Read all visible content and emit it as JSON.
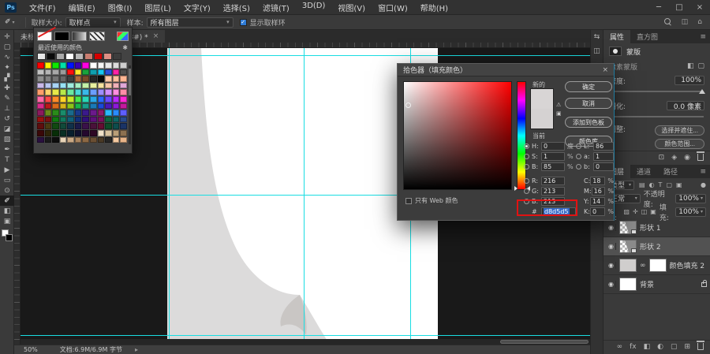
{
  "colors": {
    "guide": "#19dde2",
    "page_bg": "#dcdbdb",
    "page": "#ffffff",
    "curl": "#c9c6c4",
    "picker": "#d8d5d5",
    "selection_blue": "#3166c6",
    "annotation_red": "#e11212",
    "check_blue": "#2e7bd6"
  },
  "menubar": {
    "logo": "Ps",
    "items": [
      "文件(F)",
      "编辑(E)",
      "图像(I)",
      "图层(L)",
      "文字(Y)",
      "选择(S)",
      "滤镜(T)",
      "3D(D)",
      "视图(V)",
      "窗口(W)",
      "帮助(H)"
    ],
    "window_controls": [
      "─",
      "□",
      "×"
    ]
  },
  "options_bar": {
    "tool_glyph": "✐",
    "sample_size_label": "取样大小:",
    "sample_size_value": "取样点",
    "sample_label": "样本:",
    "sample_value": "所有图层",
    "check_glyph": "✓",
    "show_ring_label": "显示取样环"
  },
  "tab": {
    "title": "未标题-1 @ 33.3%(形状 1, RGB/8#) *",
    "close": "×"
  },
  "toolbar": {
    "tools": [
      {
        "name": "move-tool",
        "glyph": "✛",
        "selected": false
      },
      {
        "name": "marquee-tool",
        "glyph": "▢",
        "selected": false
      },
      {
        "name": "lasso-tool",
        "glyph": "∿",
        "selected": false
      },
      {
        "name": "magic-wand-tool",
        "glyph": "✦",
        "selected": false
      },
      {
        "name": "crop-tool",
        "glyph": "▞",
        "selected": false
      },
      {
        "name": "healing-brush-tool",
        "glyph": "✚",
        "selected": false
      },
      {
        "name": "brush-tool",
        "glyph": "✎",
        "selected": false
      },
      {
        "name": "clone-stamp-tool",
        "glyph": "⊥",
        "selected": false
      },
      {
        "name": "history-brush-tool",
        "glyph": "↺",
        "selected": false
      },
      {
        "name": "eraser-tool",
        "glyph": "◪",
        "selected": false
      },
      {
        "name": "gradient-tool",
        "glyph": "▧",
        "selected": false
      },
      {
        "name": "pen-tool",
        "glyph": "✒",
        "selected": false
      },
      {
        "name": "type-tool",
        "glyph": "T",
        "selected": false
      },
      {
        "name": "path-select-tool",
        "glyph": "▶",
        "selected": false
      },
      {
        "name": "rectangle-tool",
        "glyph": "▭",
        "selected": false
      },
      {
        "name": "zoom-tool",
        "glyph": "⊙",
        "selected": false
      },
      {
        "name": "eyedropper-tool",
        "glyph": "✐",
        "selected": true
      },
      {
        "name": "quick-mask-icon",
        "glyph": "◧",
        "selected": false
      },
      {
        "name": "screen-mode-icon",
        "glyph": "▣",
        "selected": false
      }
    ],
    "foreground": "#ffffff",
    "background": "#000000"
  },
  "swatches": {
    "label": "最近使用的颜色",
    "recent": [
      "#e8e8e8",
      "#0a0a0a",
      "#a8a8a8",
      "#ffffff",
      "#b8b8b8",
      "#c97d70",
      "#d40000",
      "#dd8f84",
      "#3d3d3d"
    ],
    "grid": [
      "#ff0000",
      "#fff000",
      "#0fe800",
      "#00e0a8",
      "#0014ff",
      "#3a00b4",
      "#ff00e1",
      "#ffffff",
      "#f5f5f5",
      "#e9e9e9",
      "#dcdcdc",
      "#cfcfcf",
      "#c2c2c2",
      "#b5b5b5",
      "#a8a8a8",
      "#9b9b9b",
      "#ff1010",
      "#ffe92c",
      "#1aa33c",
      "#0f9faf",
      "#19c7f0",
      "#2b4fd8",
      "#ff22a8",
      "#4d4d4d",
      "#8e8e8e",
      "#818181",
      "#747474",
      "#676767",
      "#3f3f3f",
      "#b0693c",
      "#7a4a2a",
      "#262626",
      "#0a0a0a",
      "#ffc9a8",
      "#ffbf9e",
      "#ffb694",
      "#c9b8e8",
      "#b8c6f0",
      "#a8d4f5",
      "#98e2f5",
      "#a0ece0",
      "#a8f0c4",
      "#c4f0a8",
      "#e8f0a0",
      "#f5e2a0",
      "#f5c6a8",
      "#f0b0b8",
      "#e0a8d8",
      "#ff9e6b",
      "#ffd26b",
      "#e8e84a",
      "#b8e84a",
      "#6be8a0",
      "#4ad8d8",
      "#3ab8e8",
      "#6b9eff",
      "#9e8eff",
      "#d08eff",
      "#ff8ee0",
      "#ff8ea8",
      "#ff6ba8",
      "#ff4a4a",
      "#ff8c2a",
      "#ffd42a",
      "#c9e82a",
      "#4ae84a",
      "#2ad8b8",
      "#2aa8e8",
      "#2a6bff",
      "#6b4aff",
      "#b82aff",
      "#ff2ad8",
      "#d82a8c",
      "#b81a1a",
      "#d86b1a",
      "#d8b41a",
      "#8cc41a",
      "#1ab44a",
      "#1a9e8c",
      "#1a7ab8",
      "#1a4ad8",
      "#4a1ab8",
      "#8c1ad8",
      "#c41a9e",
      "#8c1a5e",
      "#6b8c1a",
      "#2a8c1a",
      "#1a8c6b",
      "#1a6b8c",
      "#1a3a8c",
      "#3a1a8c",
      "#6b1a8c",
      "#8c1a6b",
      "#2ab8ff",
      "#2a8cff",
      "#5e5eff",
      "#991111",
      "#7a1111",
      "#117a11",
      "#117a5e",
      "#11607a",
      "#11307a",
      "#30117a",
      "#5e117a",
      "#7a1160",
      "#0f6640",
      "#0f6666",
      "#284b8c",
      "#5e0d0d",
      "#4a3a11",
      "#114a11",
      "#114a3a",
      "#11304a",
      "#1a1a4a",
      "#3a114a",
      "#4a113a",
      "#660d33",
      "#0d4d29",
      "#0d4d4d",
      "#1a3366",
      "#3a0808",
      "#2e2408",
      "#082e08",
      "#082e24",
      "#081e2e",
      "#10102e",
      "#24082e",
      "#2e0824",
      "#f0e2c9",
      "#d8c4a0",
      "#b89e78",
      "#8c7050",
      "#2a1040",
      "#1a1a1a",
      "#0d0d0d",
      "#e8d4b8",
      "#c9a884",
      "#a8825e",
      "#8c6844",
      "#6b4f33",
      "#4a3a26",
      "#262626",
      "#f5c9a0",
      "#e8b488"
    ]
  },
  "dialog": {
    "title": "拾色器（填充颜色）",
    "close": "×",
    "new_label": "新的",
    "current_label": "当前",
    "buttons": {
      "ok": "确定",
      "cancel": "取消",
      "add_to_swatches": "添加到色板",
      "color_libraries": "颜色库"
    },
    "fields_left": [
      {
        "radio": true,
        "checked": true,
        "label": "H:",
        "value": "0",
        "unit": "度"
      },
      {
        "radio": true,
        "checked": false,
        "label": "S:",
        "value": "1",
        "unit": "%"
      },
      {
        "radio": true,
        "checked": false,
        "label": "B:",
        "value": "85",
        "unit": "%"
      },
      {
        "radio": true,
        "checked": false,
        "label": "R:",
        "value": "216",
        "unit": ""
      },
      {
        "radio": true,
        "checked": false,
        "label": "G:",
        "value": "213",
        "unit": ""
      },
      {
        "radio": true,
        "checked": false,
        "label": "B:",
        "value": "213",
        "unit": ""
      }
    ],
    "fields_right": [
      {
        "radio": true,
        "checked": false,
        "label": "L:",
        "value": "86",
        "unit": ""
      },
      {
        "radio": true,
        "checked": false,
        "label": "a:",
        "value": "1",
        "unit": ""
      },
      {
        "radio": true,
        "checked": false,
        "label": "b:",
        "value": "0",
        "unit": ""
      },
      {
        "radio": false,
        "checked": false,
        "label": "C:",
        "value": "18",
        "unit": "%"
      },
      {
        "radio": false,
        "checked": false,
        "label": "M:",
        "value": "16",
        "unit": "%"
      },
      {
        "radio": false,
        "checked": false,
        "label": "Y:",
        "value": "14",
        "unit": "%"
      },
      {
        "radio": false,
        "checked": false,
        "label": "K:",
        "value": "0",
        "unit": "%"
      }
    ],
    "hex_prefix": "#",
    "hex_value": "d8d5d5",
    "web_only_label": "只有 Web 颜色"
  },
  "properties": {
    "tabs": [
      "属性",
      "直方图"
    ],
    "header": "蒙版",
    "mask_type": "像素蒙版",
    "density_label": "密度:",
    "density_value": "100%",
    "feather_label": "羽化:",
    "feather_value": "0.0 像素",
    "adjust_label": "调整:",
    "buttons": [
      "选择并遮住...",
      "颜色范围..."
    ]
  },
  "layers": {
    "tabs": [
      "图层",
      "通道",
      "路径"
    ],
    "filter_label": "类型",
    "filter_icons": [
      "▤",
      "◐",
      "T",
      "▢",
      "▣"
    ],
    "blend_mode": "正常",
    "opacity_label": "不透明度:",
    "opacity_value": "100%",
    "lock_label": "锁定:",
    "lock_icons": [
      "▨",
      "✛",
      "◫",
      "▣"
    ],
    "fill_label": "填充:",
    "fill_value": "100%",
    "items": [
      {
        "name": "形状 1",
        "kind": "shape",
        "selected": false,
        "locked": false
      },
      {
        "name": "形状 2",
        "kind": "shape",
        "selected": true,
        "locked": false
      },
      {
        "name": "颜色填充 2",
        "kind": "fill",
        "selected": false,
        "locked": false
      },
      {
        "name": "背景",
        "kind": "background",
        "selected": false,
        "locked": true
      }
    ],
    "bottom_icons": [
      "∞",
      "fx",
      "◧",
      "◐",
      "▢",
      "⊞"
    ]
  },
  "status_bar": {
    "zoom": "50%",
    "doc_info": "文档:6.9M/6.9M 字节",
    "arrow": "▸"
  }
}
